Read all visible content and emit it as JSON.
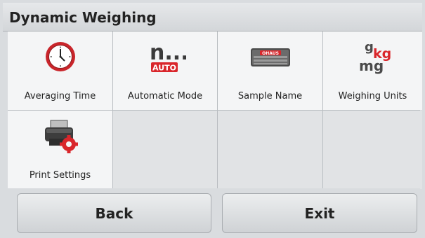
{
  "window": {
    "title": "Dynamic Weighing"
  },
  "menu": {
    "items": [
      {
        "label": "Averaging Time",
        "icon": "clock-icon"
      },
      {
        "label": "Automatic Mode",
        "icon": "auto-mode-icon",
        "icon_text_top": "n...",
        "icon_text_bottom": "AUTO"
      },
      {
        "label": "Sample Name",
        "icon": "keyboard-icon",
        "icon_text": "OHAUS"
      },
      {
        "label": "Weighing Units",
        "icon": "units-icon",
        "icon_text_g": "g",
        "icon_text_kg": "kg",
        "icon_text_mg": "mg"
      },
      {
        "label": "Print Settings",
        "icon": "printer-settings-icon"
      }
    ]
  },
  "footer": {
    "back_label": "Back",
    "exit_label": "Exit"
  },
  "colors": {
    "accent_red": "#d9262b",
    "background": "#d9dcdf"
  }
}
